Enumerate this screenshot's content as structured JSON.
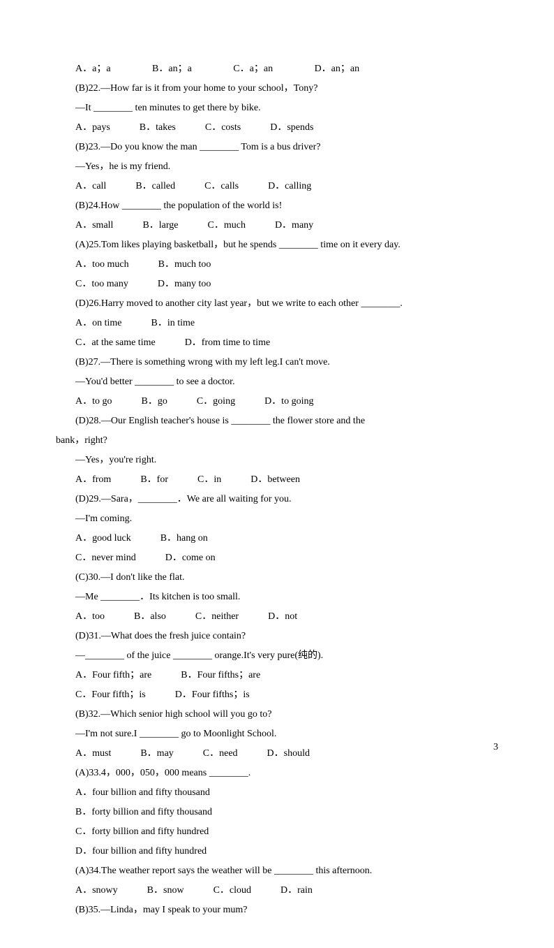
{
  "page_number": "3",
  "lines": [
    {
      "t": "A．a；a　　　　 B．an；a　　　　 C．a；an　　　　 D．an；an"
    },
    {
      "t": "(B)22.—How far is it from your home to your school，Tony?"
    },
    {
      "t": "—It ________ ten minutes to get there by bike."
    },
    {
      "t": "A．pays　　　B．takes　　　C．costs　　　D．spends"
    },
    {
      "t": "(B)23.—Do you know the man ________ Tom is a bus driver?"
    },
    {
      "t": "—Yes，he is my friend."
    },
    {
      "t": "A．call　　　B．called　　　C．calls　　　D．calling"
    },
    {
      "t": "(B)24.How ________ the population of the world is!"
    },
    {
      "t": "A．small　　　B．large　　　C．much　　　D．many"
    },
    {
      "t": "(A)25.Tom likes playing basketball，but he spends ________ time on it every day."
    },
    {
      "t": "A．too much　　　B．much too"
    },
    {
      "t": "C．too many　　　D．many too"
    },
    {
      "t": "(D)26.Harry moved to another city last year，but we write to each other ________."
    },
    {
      "t": "A．on time　　　B．in time"
    },
    {
      "t": "C．at the same time　　　D．from time to time"
    },
    {
      "t": "(B)27.—There is something wrong with my left leg.I can't move."
    },
    {
      "t": "—You'd better ________ to see a doctor."
    },
    {
      "t": "A．to go　　　B．go　　　C．going　　　D．to going"
    },
    {
      "t": "(D)28.—Our English teacher's house is ________ the flower store and the bank，right?",
      "noindent": false,
      "wrap": true
    },
    {
      "t": "—Yes，you're right."
    },
    {
      "t": "A．from　　　B．for　　　C．in　　　D．between"
    },
    {
      "t": "(D)29.—Sara，________．We are all waiting for you."
    },
    {
      "t": "—I'm coming."
    },
    {
      "t": "A．good luck　　　B．hang on"
    },
    {
      "t": "C．never mind　　　D．come on"
    },
    {
      "t": "(C)30.—I don't like the flat."
    },
    {
      "t": "—Me ________．Its kitchen is too small."
    },
    {
      "t": "A．too　　　B．also　　　C．neither　　　D．not"
    },
    {
      "t": "(D)31.—What does the fresh juice contain?"
    },
    {
      "t": "—________ of the juice ________ orange.It's very pure(纯的)."
    },
    {
      "t": "A．Four fifth；are　　　B．Four fifths；are"
    },
    {
      "t": "C．Four fifth；is　　　D．Four fifths；is"
    },
    {
      "t": "(B)32.—Which senior high school will you go to?"
    },
    {
      "t": "—I'm not sure.I ________ go to Moonlight School."
    },
    {
      "t": "A．must　　　B．may　　　C．need　　　D．should"
    },
    {
      "t": "(A)33.4，000，050，000 means ________."
    },
    {
      "t": "A．four billion and fifty thousand"
    },
    {
      "t": "B．forty billion and fifty thousand"
    },
    {
      "t": "C．forty billion and fifty hundred"
    },
    {
      "t": "D．four billion and fifty hundred"
    },
    {
      "t": "(A)34.The weather report says the weather will be ________ this afternoon."
    },
    {
      "t": "A．snowy　　　B．snow　　　C．cloud　　　D．rain"
    },
    {
      "t": "(B)35.—Linda，may I speak to your mum?"
    }
  ],
  "q28_part1": "(D)28.—Our English teacher's house is ________ the flower store and the",
  "q28_part2": "bank，right?"
}
